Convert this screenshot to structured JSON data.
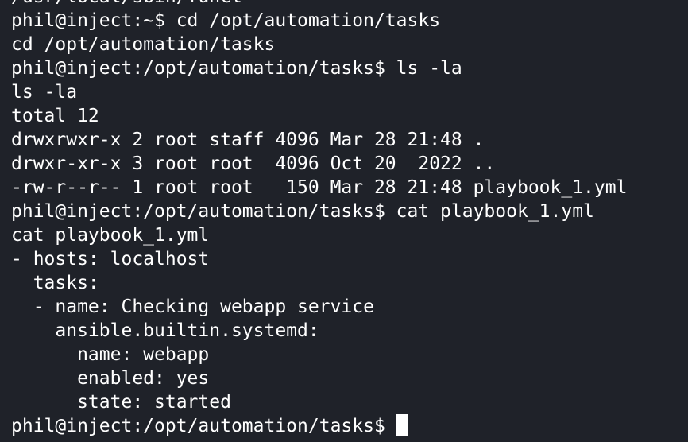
{
  "terminal": {
    "lines": [
      "/usr/local/sbin/funct",
      "phil@inject:~$ cd /opt/automation/tasks",
      "cd /opt/automation/tasks",
      "phil@inject:/opt/automation/tasks$ ls -la",
      "ls -la",
      "total 12",
      "drwxrwxr-x 2 root staff 4096 Mar 28 21:48 .",
      "drwxr-xr-x 3 root root  4096 Oct 20  2022 ..",
      "-rw-r--r-- 1 root root   150 Mar 28 21:48 playbook_1.yml",
      "phil@inject:/opt/automation/tasks$ cat playbook_1.yml",
      "cat playbook_1.yml",
      "- hosts: localhost",
      "  tasks:",
      "  - name: Checking webapp service",
      "    ansible.builtin.systemd:",
      "      name: webapp",
      "      enabled: yes",
      "      state: started"
    ],
    "prompt": "phil@inject:/opt/automation/tasks$ "
  }
}
